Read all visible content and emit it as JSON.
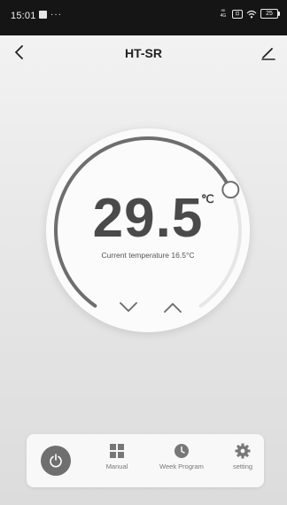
{
  "status_bar": {
    "time": "15:01",
    "dots": "···",
    "network": "ᴴᴰ",
    "network_sub": "4G",
    "sim": "⊡",
    "battery": "25"
  },
  "header": {
    "title": "HT-SR",
    "icons": {
      "back": "chevron-left-icon",
      "edit": "pencil-icon"
    }
  },
  "thermostat": {
    "set_temperature": "29.5",
    "unit": "℃",
    "current_temperature_text": "Current temperature 16.5°C",
    "dial_level": 0.72,
    "colors": {
      "arc_active": "#6e6e6e",
      "arc_track": "#e6e6e6",
      "knob": "#ffffff"
    }
  },
  "bottom_bar": {
    "power": {
      "icon": "power-icon",
      "color": "#6f6f6f"
    },
    "items": [
      {
        "label": "Manual",
        "icon": "grid-icon"
      },
      {
        "label": "Week Program",
        "icon": "clock-icon"
      },
      {
        "label": "setting",
        "icon": "gear-icon"
      }
    ]
  }
}
